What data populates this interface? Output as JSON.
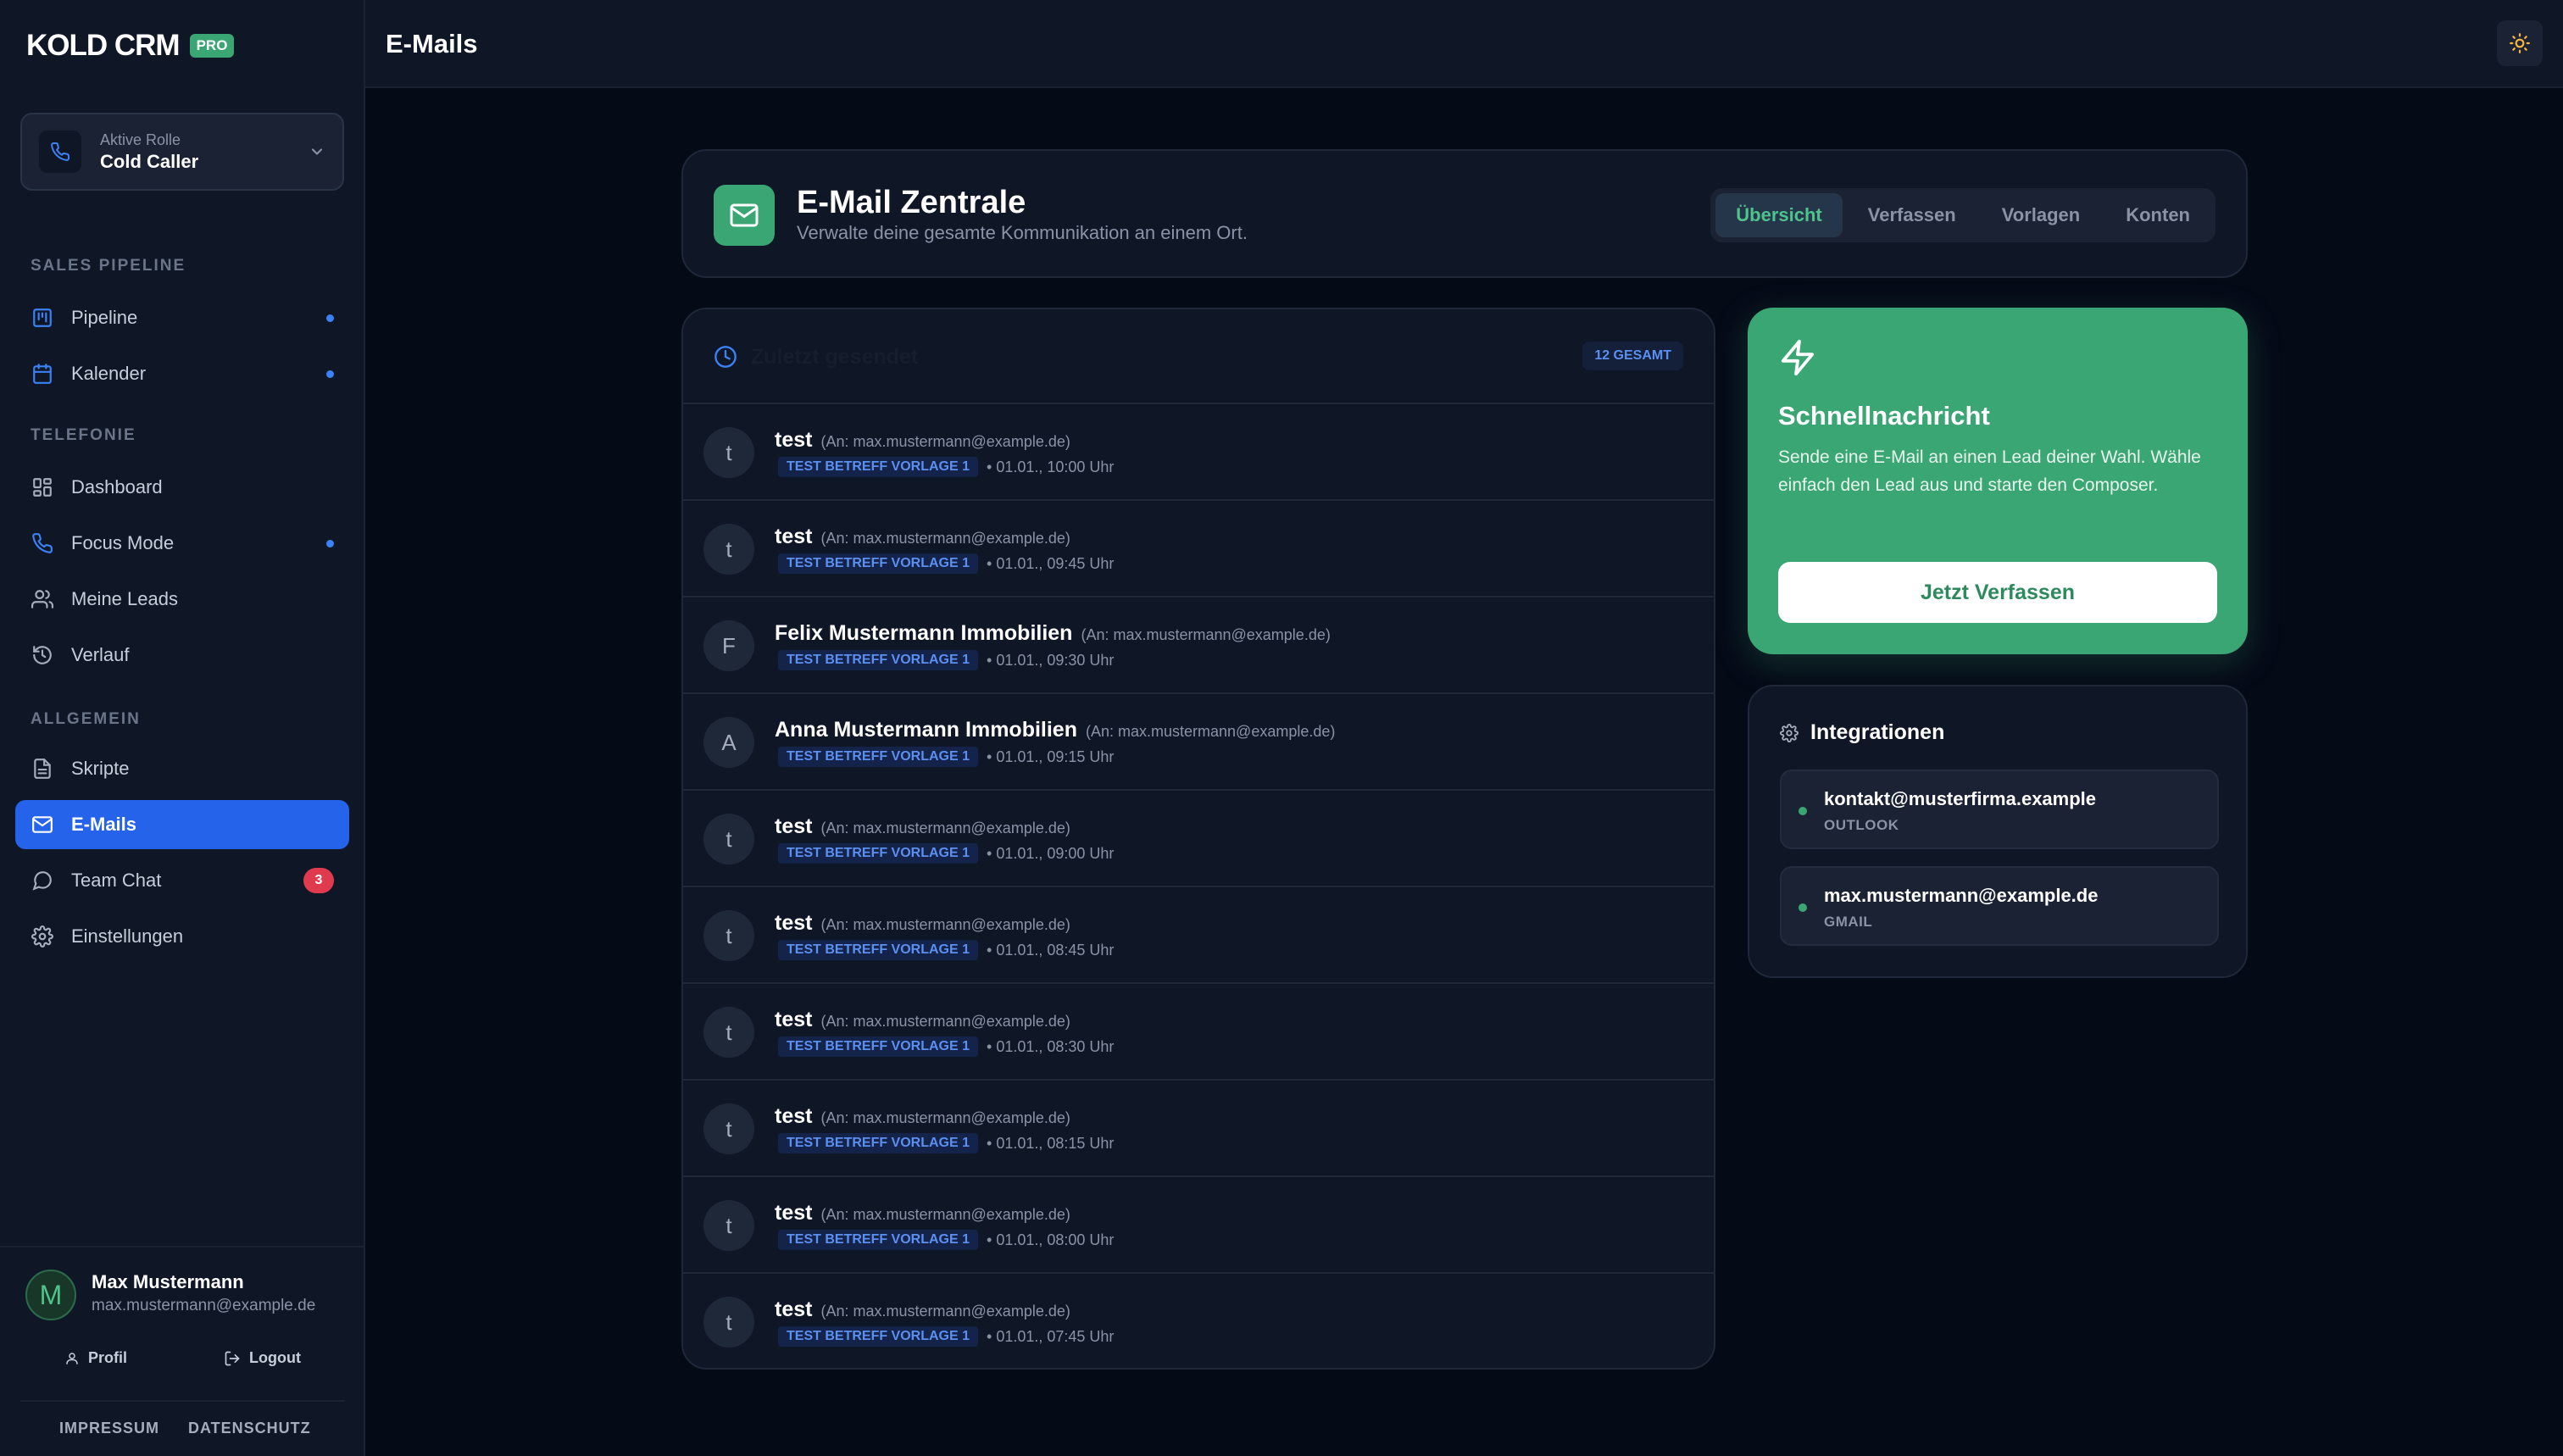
{
  "brand": {
    "name": "KOLD CRM",
    "badge": "PRO"
  },
  "role": {
    "label": "Aktive Rolle",
    "value": "Cold Caller"
  },
  "sidebar": {
    "sections": [
      {
        "label": "SALES PIPELINE"
      },
      {
        "label": "TELEFONIE"
      },
      {
        "label": "ALLGEMEIN"
      }
    ],
    "items": [
      {
        "label": "Pipeline",
        "icon": "kanban-icon",
        "dot": true
      },
      {
        "label": "Kalender",
        "icon": "calendar-icon",
        "dot": true
      },
      {
        "label": "Dashboard",
        "icon": "dashboard-icon"
      },
      {
        "label": "Focus Mode",
        "icon": "phone-icon",
        "dot": true
      },
      {
        "label": "Meine Leads",
        "icon": "users-icon"
      },
      {
        "label": "Verlauf",
        "icon": "history-icon"
      },
      {
        "label": "Skripte",
        "icon": "document-icon"
      },
      {
        "label": "E-Mails",
        "icon": "mail-icon",
        "active": true
      },
      {
        "label": "Team Chat",
        "icon": "chat-icon",
        "badge": "3"
      },
      {
        "label": "Einstellungen",
        "icon": "gear-icon"
      }
    ]
  },
  "user": {
    "initial": "M",
    "name": "Max Mustermann",
    "email": "max.mustermann@example.de",
    "profile_label": "Profil",
    "logout_label": "Logout",
    "impressum_label": "IMPRESSUM",
    "datenschutz_label": "DATENSCHUTZ"
  },
  "header": {
    "title": "E-Mails"
  },
  "email_center": {
    "title": "E-Mail Zentrale",
    "subtitle": "Verwalte deine gesamte Kommunikation an einem Ort.",
    "tabs": [
      {
        "label": "Übersicht",
        "active": true
      },
      {
        "label": "Verfassen"
      },
      {
        "label": "Vorlagen"
      },
      {
        "label": "Konten"
      }
    ]
  },
  "sent": {
    "title": "Zuletzt gesendet",
    "count": "12 GESAMT",
    "rows": [
      {
        "initial": "t",
        "name": "test",
        "to": "(An: max.mustermann@example.de)",
        "tag": "TEST BETREFF VORLAGE 1",
        "time": "• 01.01., 10:00 Uhr"
      },
      {
        "initial": "t",
        "name": "test",
        "to": "(An: max.mustermann@example.de)",
        "tag": "TEST BETREFF VORLAGE 1",
        "time": "• 01.01., 09:45 Uhr"
      },
      {
        "initial": "F",
        "name": "Felix Mustermann Immobilien",
        "to": "(An: max.mustermann@example.de)",
        "tag": "TEST BETREFF VORLAGE 1",
        "time": "• 01.01., 09:30 Uhr"
      },
      {
        "initial": "A",
        "name": "Anna Mustermann Immobilien",
        "to": "(An: max.mustermann@example.de)",
        "tag": "TEST BETREFF VORLAGE 1",
        "time": "• 01.01., 09:15 Uhr"
      },
      {
        "initial": "t",
        "name": "test",
        "to": "(An: max.mustermann@example.de)",
        "tag": "TEST BETREFF VORLAGE 1",
        "time": "• 01.01., 09:00 Uhr"
      },
      {
        "initial": "t",
        "name": "test",
        "to": "(An: max.mustermann@example.de)",
        "tag": "TEST BETREFF VORLAGE 1",
        "time": "• 01.01., 08:45 Uhr"
      },
      {
        "initial": "t",
        "name": "test",
        "to": "(An: max.mustermann@example.de)",
        "tag": "TEST BETREFF VORLAGE 1",
        "time": "• 01.01., 08:30 Uhr"
      },
      {
        "initial": "t",
        "name": "test",
        "to": "(An: max.mustermann@example.de)",
        "tag": "TEST BETREFF VORLAGE 1",
        "time": "• 01.01., 08:15 Uhr"
      },
      {
        "initial": "t",
        "name": "test",
        "to": "(An: max.mustermann@example.de)",
        "tag": "TEST BETREFF VORLAGE 1",
        "time": "• 01.01., 08:00 Uhr"
      },
      {
        "initial": "t",
        "name": "test",
        "to": "(An: max.mustermann@example.de)",
        "tag": "TEST BETREFF VORLAGE 1",
        "time": "• 01.01., 07:45 Uhr"
      }
    ]
  },
  "quick": {
    "title": "Schnellnachricht",
    "text": "Sende eine E-Mail an einen Lead deiner Wahl. Wähle einfach den Lead aus und starte den Composer.",
    "button": "Jetzt Verfassen"
  },
  "integrations": {
    "title": "Integrationen",
    "items": [
      {
        "email": "kontakt@musterfirma.example",
        "type": "OUTLOOK"
      },
      {
        "email": "max.mustermann@example.de",
        "type": "GMAIL"
      }
    ]
  },
  "colors": {
    "accent_green": "#3aa674",
    "accent_blue": "#2563eb",
    "badge_red": "#e03a4f",
    "background": "#050a17",
    "panel": "#0f1626"
  }
}
